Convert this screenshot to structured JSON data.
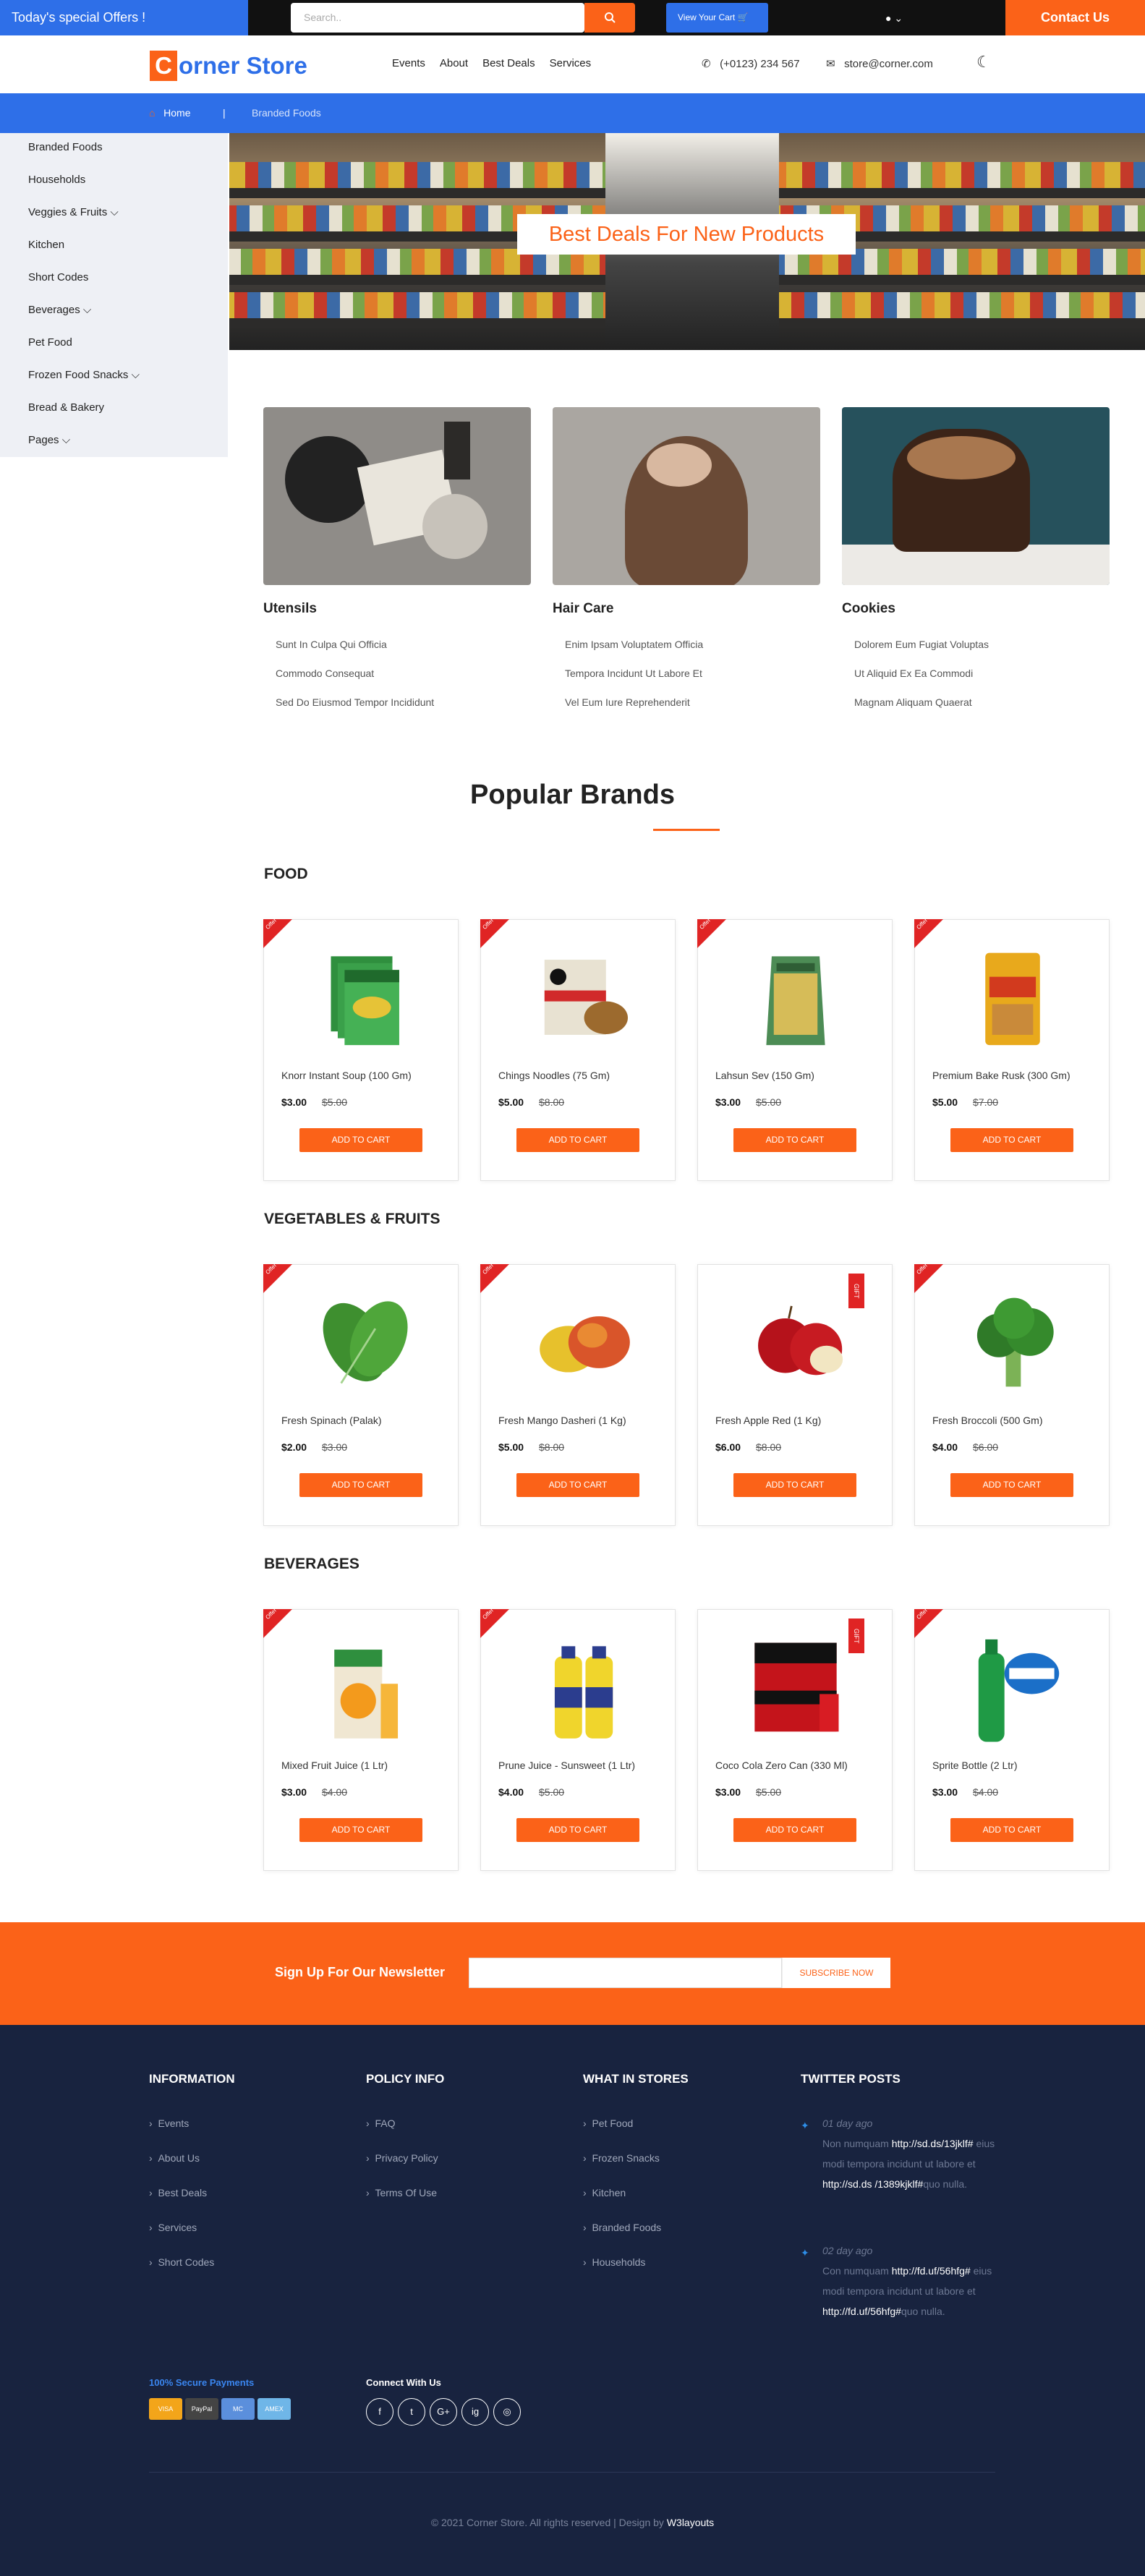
{
  "topbar": {
    "offers": "Today's special Offers !",
    "search_placeholder": "Search..",
    "cart": "View Your Cart",
    "contact": "Contact Us"
  },
  "header": {
    "logo_first": "C",
    "logo_rest": "orner Store",
    "nav": [
      "Events",
      "About",
      "Best Deals",
      "Services"
    ],
    "phone": "(+0123) 234 567",
    "email": "store@corner.com"
  },
  "breadcrumb": {
    "home": "Home",
    "sep": "|",
    "current": "Branded Foods"
  },
  "sidebar": [
    "Branded Foods",
    "Households",
    "Veggies & Fruits ⌵",
    "Kitchen",
    "Short Codes",
    "Beverages ⌵",
    "Pet Food",
    "Frozen Food Snacks ⌵",
    "Bread & Bakery",
    "Pages ⌵"
  ],
  "hero": {
    "title": "Best Deals For New Products"
  },
  "categories": [
    {
      "title": "Utensils",
      "links": [
        "Sunt In Culpa Qui Officia",
        "Commodo Consequat",
        "Sed Do Eiusmod Tempor Incididunt"
      ]
    },
    {
      "title": "Hair Care",
      "links": [
        "Enim Ipsam Voluptatem Officia",
        "Tempora Incidunt Ut Labore Et",
        "Vel Eum Iure Reprehenderit"
      ]
    },
    {
      "title": "Cookies",
      "links": [
        "Dolorem Eum Fugiat Voluptas",
        "Ut Aliquid Ex Ea Commodi",
        "Magnam Aliquam Quaerat"
      ]
    }
  ],
  "popular": {
    "title": "Popular Brands"
  },
  "sections": [
    {
      "title": "FOOD",
      "products": [
        {
          "name": "Knorr Instant Soup (100 Gm)",
          "price": "$3.00",
          "old": "$5.00",
          "tag": "offer",
          "icon": "soup-box"
        },
        {
          "name": "Chings Noodles (75 Gm)",
          "price": "$5.00",
          "old": "$8.00",
          "tag": "offer",
          "icon": "noodles-pack"
        },
        {
          "name": "Lahsun Sev (150 Gm)",
          "price": "$3.00",
          "old": "$5.00",
          "tag": "offer",
          "icon": "snack-pack"
        },
        {
          "name": "Premium Bake Rusk (300 Gm)",
          "price": "$5.00",
          "old": "$7.00",
          "tag": "offer",
          "icon": "rusk-pack"
        }
      ]
    },
    {
      "title": "VEGETABLES & FRUITS",
      "products": [
        {
          "name": "Fresh Spinach (Palak)",
          "price": "$2.00",
          "old": "$3.00",
          "tag": "offer",
          "icon": "spinach"
        },
        {
          "name": "Fresh Mango Dasheri (1 Kg)",
          "price": "$5.00",
          "old": "$8.00",
          "tag": "offer",
          "icon": "mango"
        },
        {
          "name": "Fresh Apple Red (1 Kg)",
          "price": "$6.00",
          "old": "$8.00",
          "tag": "gift",
          "icon": "apple"
        },
        {
          "name": "Fresh Broccoli (500 Gm)",
          "price": "$4.00",
          "old": "$6.00",
          "tag": "offer",
          "icon": "broccoli"
        }
      ]
    },
    {
      "title": "BEVERAGES",
      "products": [
        {
          "name": "Mixed Fruit Juice (1 Ltr)",
          "price": "$3.00",
          "old": "$4.00",
          "tag": "offer",
          "icon": "juice-carton"
        },
        {
          "name": "Prune Juice - Sunsweet (1 Ltr)",
          "price": "$4.00",
          "old": "$5.00",
          "tag": "offer",
          "icon": "juice-bottles"
        },
        {
          "name": "Coco Cola Zero Can (330 Ml)",
          "price": "$3.00",
          "old": "$5.00",
          "tag": "gift",
          "icon": "cola-pack"
        },
        {
          "name": "Sprite Bottle (2 Ltr)",
          "price": "$3.00",
          "old": "$4.00",
          "tag": "offer",
          "icon": "sprite-bottle"
        }
      ]
    }
  ],
  "add_label": "ADD TO CART",
  "offer_label": "Offer",
  "gift_label": "GIFT",
  "newsletter": {
    "label": "Sign Up For Our Newsletter",
    "button": "SUBSCRIBE NOW"
  },
  "footer": {
    "cols": [
      {
        "title": "INFORMATION",
        "links": [
          "Events",
          "About Us",
          "Best Deals",
          "Services",
          "Short Codes"
        ]
      },
      {
        "title": "POLICY INFO",
        "links": [
          "FAQ",
          "Privacy Policy",
          "Terms Of Use"
        ]
      },
      {
        "title": "WHAT IN STORES",
        "links": [
          "Pet Food",
          "Frozen Snacks",
          "Kitchen",
          "Branded Foods",
          "Households"
        ]
      },
      {
        "title": "TWITTER POSTS",
        "links": []
      }
    ],
    "tweets": [
      {
        "date": "01 day ago",
        "a": "Non numquam ",
        "u1": "http://sd.ds/13jklf#",
        "b": " eius modi tempora incidunt ut labore et ",
        "u2": "http://sd.ds /1389kjklf#",
        "c": "quo nulla."
      },
      {
        "date": "02 day ago",
        "a": "Con numquam ",
        "u1": "http://fd.uf/56hfg#",
        "b": " eius modi tempora incidunt ut labore et ",
        "u2": "http://fd.uf/56hfg#",
        "c": "quo nulla."
      }
    ],
    "secure": "100% Secure Payments",
    "cards": [
      "VISA",
      "PayPal",
      "MC",
      "AMEX"
    ],
    "connect": "Connect With Us",
    "socials": [
      "f",
      "t",
      "G+",
      "ig",
      "◎"
    ],
    "copy_a": "© 2021 Corner Store. All rights reserved | Design by ",
    "copy_b": "W3layouts"
  }
}
